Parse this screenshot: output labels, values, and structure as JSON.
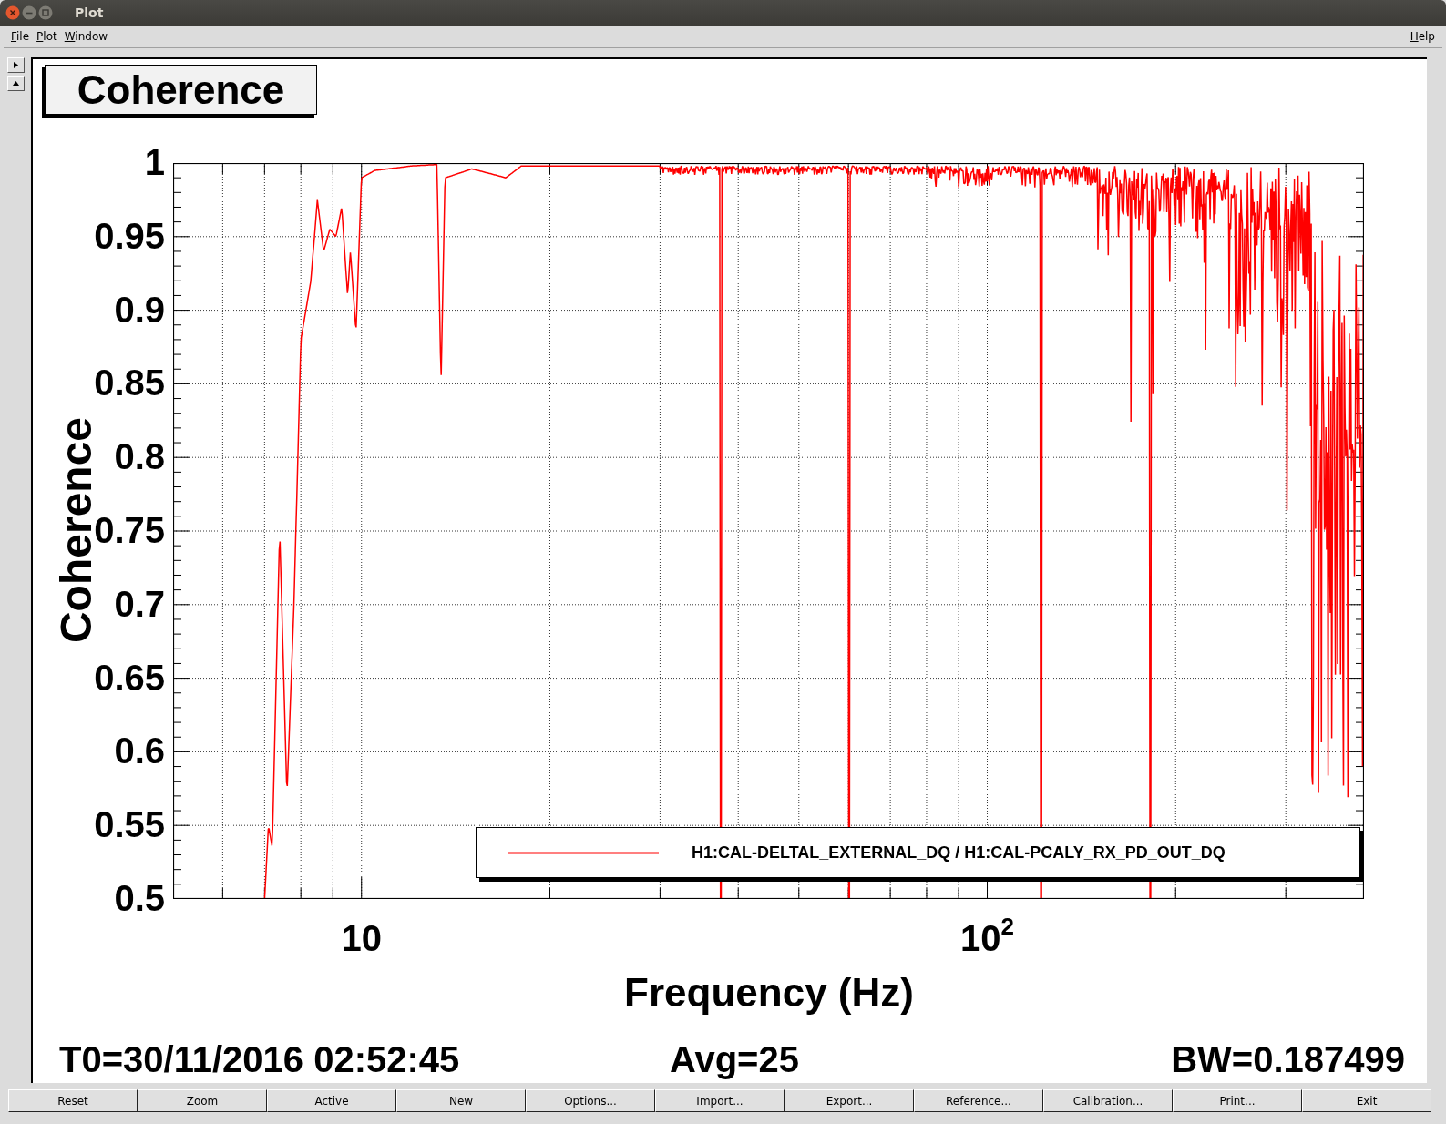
{
  "window": {
    "title": "Plot"
  },
  "menu": {
    "left": [
      "File",
      "Plot",
      "Window"
    ],
    "right": [
      "Help"
    ]
  },
  "plot": {
    "title": "Coherence",
    "ylabel": "Coherence",
    "xlabel": "Frequency (Hz)",
    "yticks": [
      "1",
      "0.95",
      "0.9",
      "0.85",
      "0.8",
      "0.75",
      "0.7",
      "0.65",
      "0.6",
      "0.55",
      "0.5"
    ],
    "xticks": [
      "10",
      "10$^{2}$"
    ],
    "legend": [
      "H1:CAL-DELTAL_EXTERNAL_DQ / H1:CAL-PCALY_RX_PD_OUT_DQ"
    ],
    "info": [
      "T0=30/11/2016 02:52:45",
      "Avg=25",
      "BW=0.187499"
    ]
  },
  "buttons": [
    "Reset",
    "Zoom",
    "Active",
    "New",
    "Options...",
    "Import...",
    "Export...",
    "Reference...",
    "Calibration...",
    "Print...",
    "Exit"
  ]
}
